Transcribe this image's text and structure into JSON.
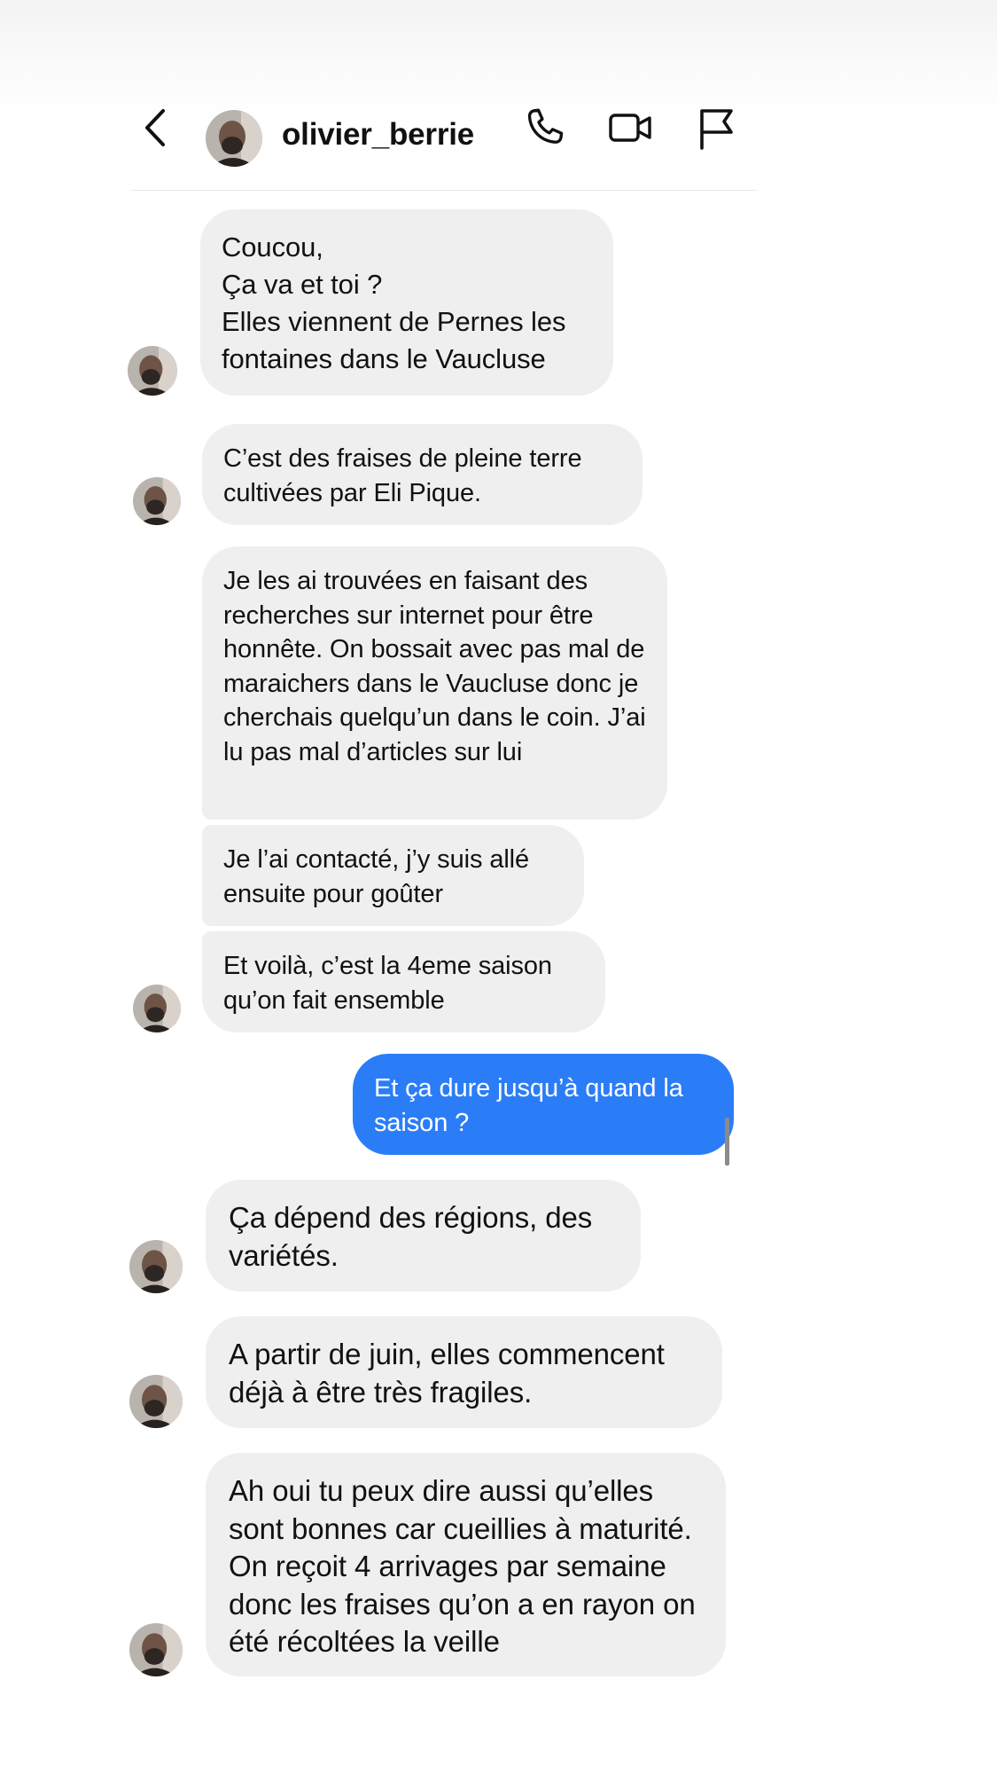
{
  "header": {
    "username": "olivier_berrie"
  },
  "icons": {
    "back": "chevron-left-icon",
    "phone": "phone-icon",
    "video": "video-camera-icon",
    "flag": "flag-icon"
  },
  "colors": {
    "sent_bubble": "#2b7df7",
    "received_bubble": "#efefef",
    "text": "#111111"
  },
  "messages": [
    {
      "from": "olivier_berrie",
      "text": "Coucou,\nÇa va et toi ?\nElles viennent de Pernes les fontaines dans le Vaucluse"
    },
    {
      "from": "olivier_berrie",
      "text": "C’est des fraises de pleine terre cultivées par Eli Pique."
    },
    {
      "from": "olivier_berrie",
      "text": "Je les ai trouvées en faisant des recherches sur internet pour être honnête. On bossait avec pas mal de maraichers dans le Vaucluse donc je cherchais quelqu’un dans le coin. J’ai lu pas mal d’articles sur lui"
    },
    {
      "from": "olivier_berrie",
      "text": "Je l’ai contacté, j’y suis allé ensuite pour goûter"
    },
    {
      "from": "olivier_berrie",
      "text": "Et voilà, c’est la 4eme saison qu’on fait ensemble"
    },
    {
      "from": "me",
      "text": "Et ça dure jusqu’à quand la saison ?"
    },
    {
      "from": "olivier_berrie",
      "text": "Ça dépend des régions, des variétés."
    },
    {
      "from": "olivier_berrie",
      "text": "A partir de juin, elles commencent déjà à être très fragiles."
    },
    {
      "from": "olivier_berrie",
      "text": "Ah oui tu peux dire aussi qu’elles sont bonnes car cueillies à maturité. On reçoit 4 arrivages par semaine donc les fraises qu’on a en rayon on été récoltées la veille"
    }
  ]
}
